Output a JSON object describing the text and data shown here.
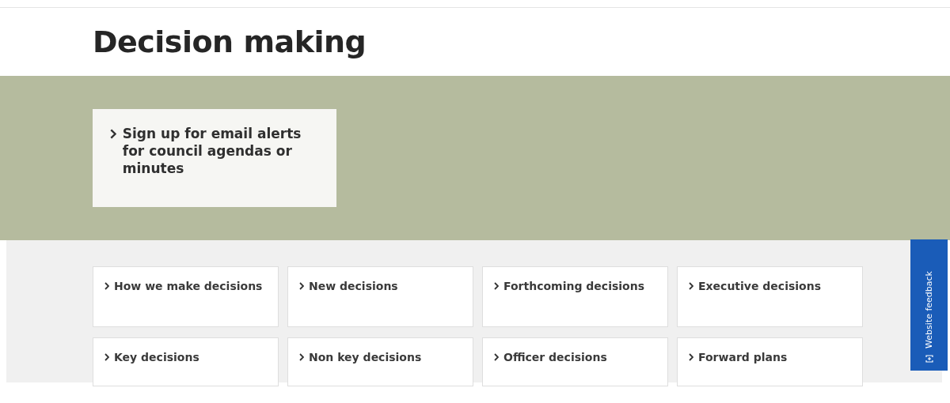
{
  "page_title": "Decision making",
  "promo": {
    "label": "Sign up for email alerts for council agendas or minutes"
  },
  "links": [
    {
      "label": "How we make decisions"
    },
    {
      "label": "New decisions"
    },
    {
      "label": "Forthcoming decisions"
    },
    {
      "label": "Executive decisions"
    },
    {
      "label": "Key decisions"
    },
    {
      "label": "Non key decisions"
    },
    {
      "label": "Officer decisions"
    },
    {
      "label": "Forward plans"
    }
  ],
  "feedback_tab": {
    "label": "Website feedback"
  }
}
